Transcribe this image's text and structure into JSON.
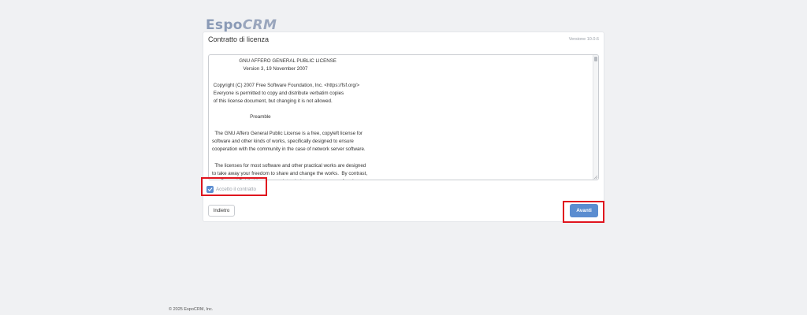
{
  "logo": {
    "part1": "Espo",
    "part2": "CRM"
  },
  "header": {
    "title": "Contratto di licenza",
    "version": "Versione 10.0.6"
  },
  "license": {
    "text": "                    GNU AFFERO GENERAL PUBLIC LICENSE\n                       Version 3, 19 November 2007\n\n Copyright (C) 2007 Free Software Foundation, Inc. <https://fsf.org/>\n Everyone is permitted to copy and distribute verbatim copies\n of this license document, but changing it is not allowed.\n\n                            Preamble\n\n  The GNU Affero General Public License is a free, copyleft license for\nsoftware and other kinds of works, specifically designed to ensure\ncooperation with the community in the case of network server software.\n\n  The licenses for most software and other practical works are designed\nto take away your freedom to share and change the works.  By contrast,\nour General Public Licenses are intended to guarantee your freedom to"
  },
  "accept": {
    "label": "Accetto il contratto",
    "checked": true
  },
  "buttons": {
    "back_label": "Indietro",
    "next_label": "Avanti"
  },
  "footer": {
    "copyright": "© 2025 EspoCRM, Inc."
  },
  "colors": {
    "accent": "#5b8dd0",
    "highlight": "#e0141e",
    "background": "#f0f1f3"
  },
  "icons": {
    "checkbox": "check-icon",
    "resize": "resize-grip-icon"
  }
}
